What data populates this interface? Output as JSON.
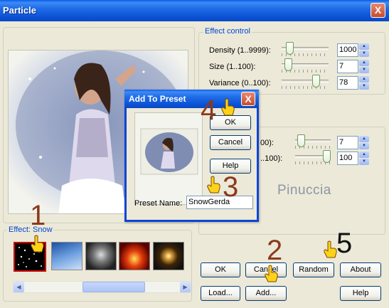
{
  "window": {
    "title": "Particle",
    "close_label": "X"
  },
  "effect_control": {
    "legend": "Effect control",
    "rows": [
      {
        "label": "Density (1..9999):",
        "value": "1000",
        "level": 0.1
      },
      {
        "label": "Size (1..100):",
        "value": "7",
        "level": 0.07
      },
      {
        "label": "Variance (0..100):",
        "value": "78",
        "level": 0.78
      }
    ]
  },
  "emitter": {
    "legend_fragment": "ers",
    "rows": [
      {
        "label": "00):",
        "value": "7",
        "level": 0.07
      },
      {
        "label": "..100):",
        "value": "100",
        "level": 1.0
      }
    ]
  },
  "effect_gallery": {
    "legend": "Effect: Snow",
    "tiles": [
      "snow",
      "sky",
      "smoke",
      "fire",
      "starburst"
    ],
    "selected": "snow"
  },
  "main_buttons": {
    "ok": "OK",
    "cancel": "Cancel",
    "random": "Random",
    "about": "About",
    "load": "Load...",
    "add": "Add...",
    "help": "Help"
  },
  "dialog": {
    "title": "Add To Preset",
    "close_label": "X",
    "ok": "OK",
    "cancel": "Cancel",
    "help": "Help",
    "preset_label": "Preset Name:",
    "preset_value": "SnowGerda"
  },
  "annotations": [
    "1",
    "2",
    "3",
    "4",
    "5"
  ],
  "watermark": "Pinuccia",
  "colors": {
    "accent_blue": "#0046d5",
    "title_blue": "#0a5ee8",
    "marker_brown": "#8b3a1c",
    "selection_red": "#d40000"
  }
}
